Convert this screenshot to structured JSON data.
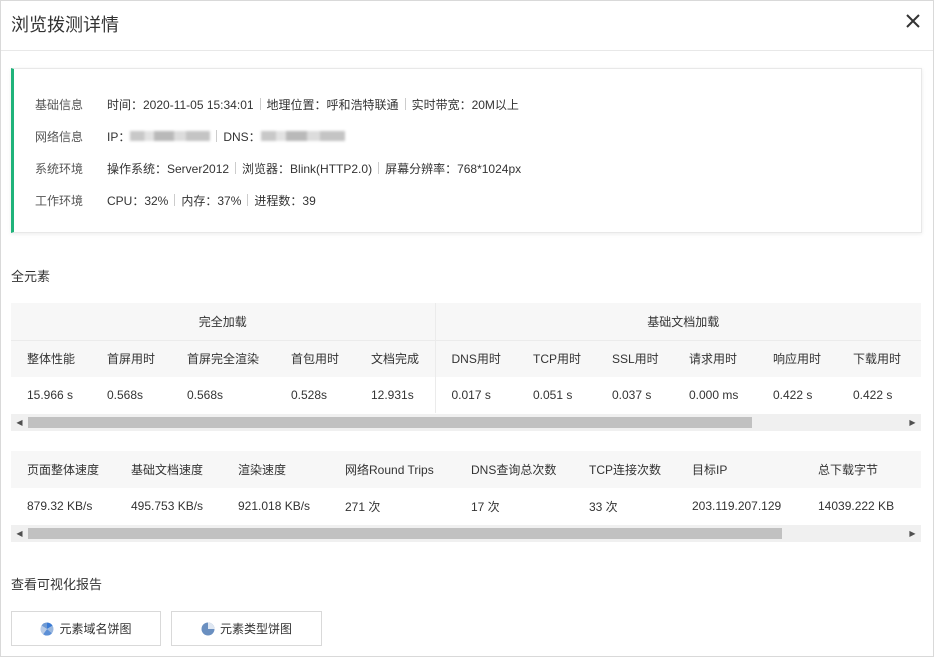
{
  "dialog": {
    "title": "浏览拨测详情"
  },
  "info": {
    "basic_label": "基础信息",
    "time": "时间：2020-11-05 15:34:01",
    "location": "地理位置：呼和浩特联通",
    "bandwidth": "实时带宽：20M以上",
    "network_label": "网络信息",
    "ip_label": "IP：",
    "dns_label": "DNS：",
    "system_label": "系统环境",
    "os": "操作系统：Server2012",
    "browser": "浏览器：Blink(HTTP2.0)",
    "resolution": "屏幕分辨率：768*1024px",
    "work_label": "工作环境",
    "cpu": "CPU：32%",
    "memory": "内存：37%",
    "processes": "进程数：39"
  },
  "elements_section": {
    "title": "全元素"
  },
  "table1": {
    "group_full": "完全加载",
    "group_doc": "基础文档加载",
    "headers": [
      "整体性能",
      "首屏用时",
      "首屏完全渲染",
      "首包用时",
      "文档完成",
      "DNS用时",
      "TCP用时",
      "SSL用时",
      "请求用时",
      "响应用时",
      "下载用时"
    ],
    "row": [
      "15.966 s",
      "0.568s",
      "0.568s",
      "0.528s",
      "12.931s",
      "0.017 s",
      "0.051 s",
      "0.037 s",
      "0.000 ms",
      "0.422 s",
      "0.422 s"
    ]
  },
  "table2": {
    "headers": [
      "页面整体速度",
      "基础文档速度",
      "渲染速度",
      "网络Round Trips",
      "DNS查询总次数",
      "TCP连接次数",
      "目标IP",
      "总下载字节"
    ],
    "row": [
      "879.32 KB/s",
      "495.753 KB/s",
      "921.018 KB/s",
      "271 次",
      "17 次",
      "33 次",
      "203.119.207.129",
      "14039.222 KB"
    ]
  },
  "report_section": {
    "title": "查看可视化报告"
  },
  "buttons": {
    "domain_pie": "元素域名饼图",
    "type_pie": "元素类型饼图"
  },
  "icons": {
    "close": "close-icon",
    "domain_pie": "domain-pie-icon",
    "type_pie": "pie-chart-icon"
  },
  "colors": {
    "accent": "#1fb37a"
  }
}
